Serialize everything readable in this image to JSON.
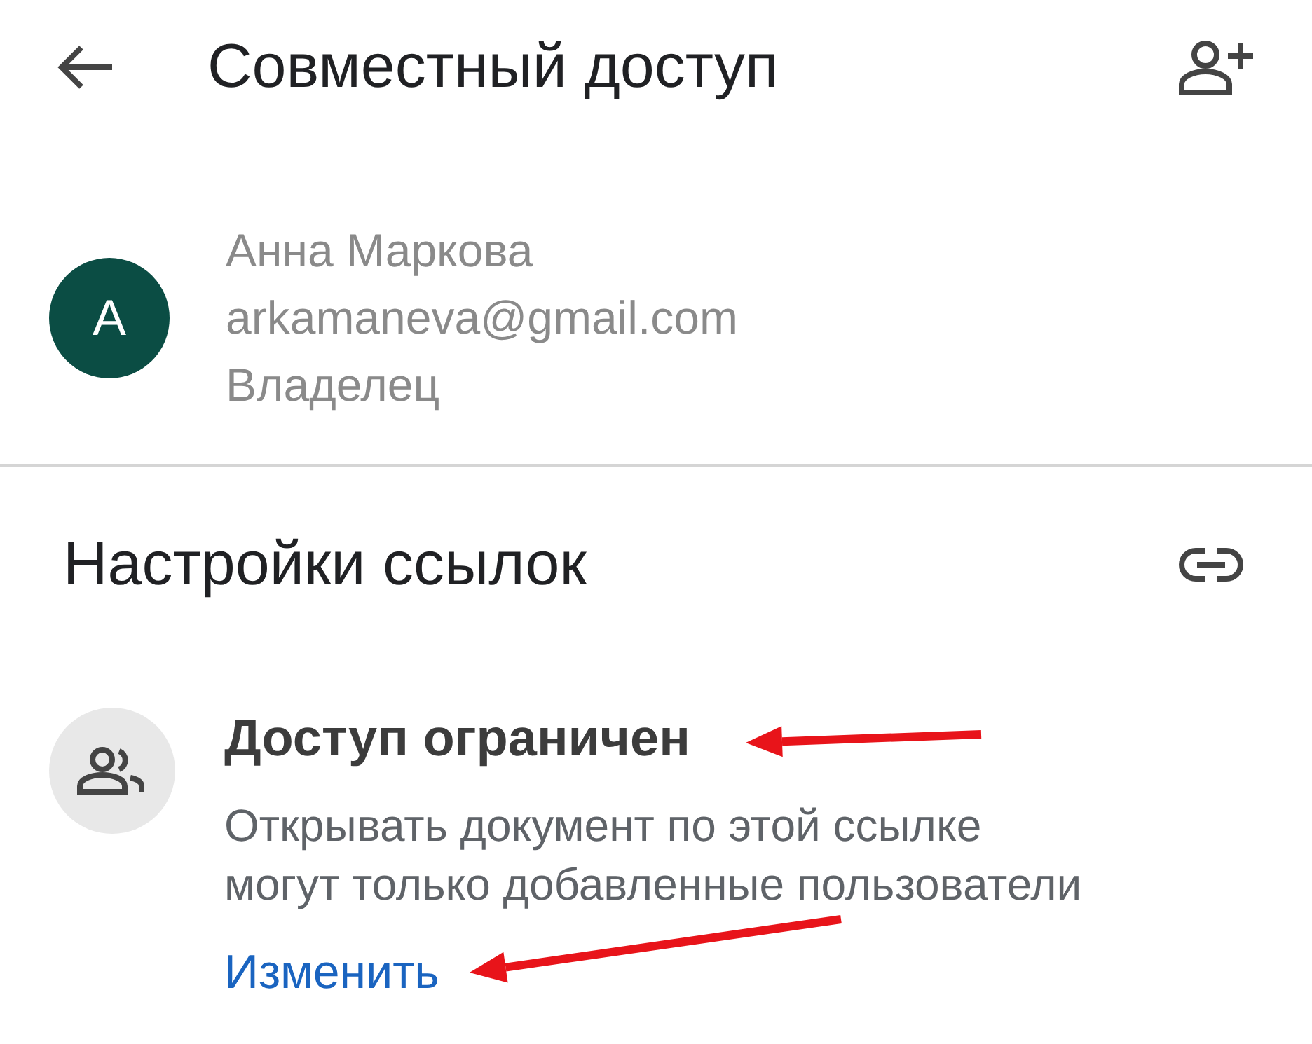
{
  "header": {
    "title": "Совместный доступ"
  },
  "people": [
    {
      "initial": "А",
      "color": "#0b4d44",
      "name": "Анна Маркова",
      "email": "arkamaneva@gmail.com",
      "role": "Владелец"
    }
  ],
  "link_settings": {
    "title": "Настройки ссылок",
    "access_title": "Доступ ограничен",
    "description": "Открывать документ по этой ссылке могут только добавленные пользователи",
    "change_link": "Изменить"
  },
  "annotations": [
    {
      "kind": "arrow",
      "color": "#e8141a"
    },
    {
      "kind": "arrow",
      "color": "#e8141a"
    }
  ]
}
